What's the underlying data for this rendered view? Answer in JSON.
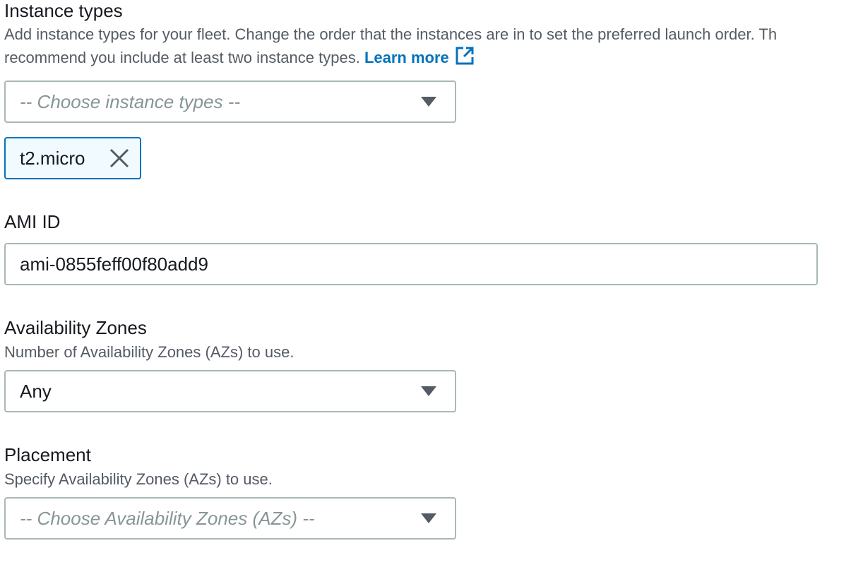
{
  "instance_types": {
    "label": "Instance types",
    "description_line1": "Add instance types for your fleet. Change the order that the instances are in to set the preferred launch order. Th",
    "description_line2": "recommend you include at least two instance types.",
    "learn_more": "Learn more",
    "select_placeholder": "-- Choose instance types --",
    "tokens": [
      {
        "label": "t2.micro"
      }
    ]
  },
  "ami": {
    "label": "AMI ID",
    "value": "ami-0855feff00f80add9"
  },
  "availability_zones": {
    "label": "Availability Zones",
    "description": "Number of Availability Zones (AZs) to use.",
    "selected": "Any"
  },
  "placement": {
    "label": "Placement",
    "description": "Specify Availability Zones (AZs) to use.",
    "select_placeholder": "-- Choose Availability Zones (AZs) --"
  },
  "colors": {
    "link": "#0073bb",
    "token_border": "#0073bb",
    "token_background": "#f1faff",
    "border": "#aab7b8",
    "placeholder": "#879596",
    "text": "#16191f",
    "secondary_text": "#545b64"
  },
  "icons": {
    "external_link": "external-link-icon",
    "dropdown": "caret-down-icon",
    "dismiss": "close-icon"
  }
}
